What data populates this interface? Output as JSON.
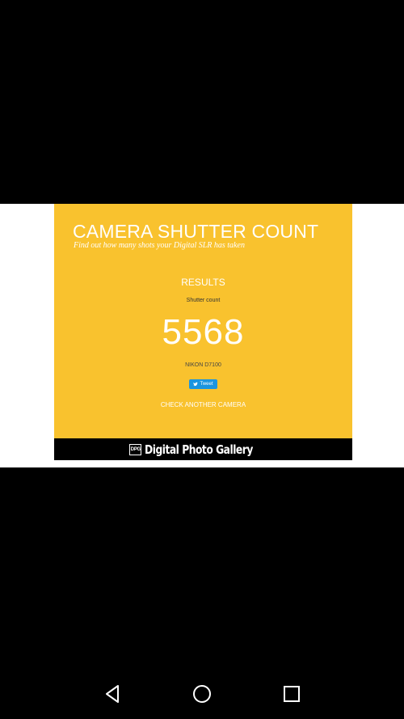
{
  "page": {
    "title": "CAMERA SHUTTER COUNT",
    "subtitle": "Find out how many shots your Digital SLR has taken",
    "results_heading": "RESULTS",
    "shutter_count_label": "Shutter count",
    "shutter_count_value": "5568",
    "camera_model": "NIKON D7100",
    "tweet_label": "Tweet",
    "check_another_label": "CHECK ANOTHER CAMERA"
  },
  "footer": {
    "logo_text": "DPG",
    "brand": "Digital Photo Gallery"
  },
  "system_nav": {
    "back_icon": "back-triangle-icon",
    "home_icon": "home-circle-icon",
    "recents_icon": "recents-square-icon"
  },
  "colors": {
    "card_background": "#f9c22e",
    "tweet_button": "#1b95e0",
    "background": "#000000"
  }
}
